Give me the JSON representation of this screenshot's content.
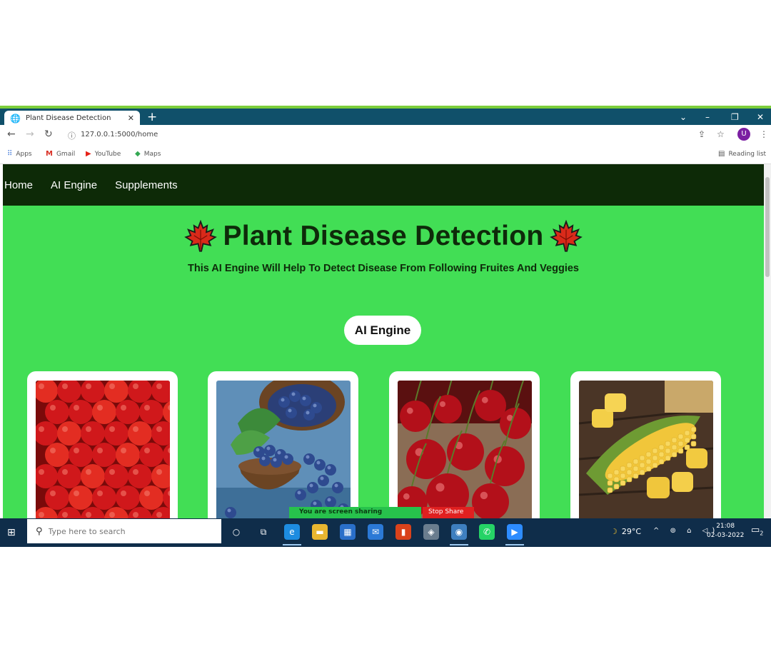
{
  "browser": {
    "tab_title": "Plant Disease Detection",
    "tab_close": "✕",
    "new_tab": "+",
    "url": "127.0.0.1:5000/home",
    "profile_initial": "U",
    "bookmarks": [
      {
        "label": "Apps",
        "icon": "apps-grid-icon"
      },
      {
        "label": "Gmail",
        "icon": "gmail-icon"
      },
      {
        "label": "YouTube",
        "icon": "youtube-icon"
      },
      {
        "label": "Maps",
        "icon": "maps-icon"
      }
    ],
    "reading_list": "Reading list"
  },
  "page": {
    "nav": [
      "Home",
      "AI Engine",
      "Supplements"
    ],
    "title": "Plant Disease Detection",
    "subtitle": "This AI Engine Will Help To Detect Disease From Following Fruites And Veggies",
    "engine_button": "AI Engine",
    "cards": [
      {
        "subject": "apples"
      },
      {
        "subject": "blueberries"
      },
      {
        "subject": "cherries"
      },
      {
        "subject": "corn"
      }
    ],
    "colors": {
      "background": "#42de55",
      "navbar": "#0d2a07",
      "leaf": "#d92a1a"
    }
  },
  "screen_share": {
    "message": "You are screen sharing",
    "stop": "Stop Share"
  },
  "taskbar": {
    "search_placeholder": "Type here to search",
    "temperature": "29°C",
    "time": "21:08",
    "date": "02-03-2022",
    "notifications": "2"
  }
}
